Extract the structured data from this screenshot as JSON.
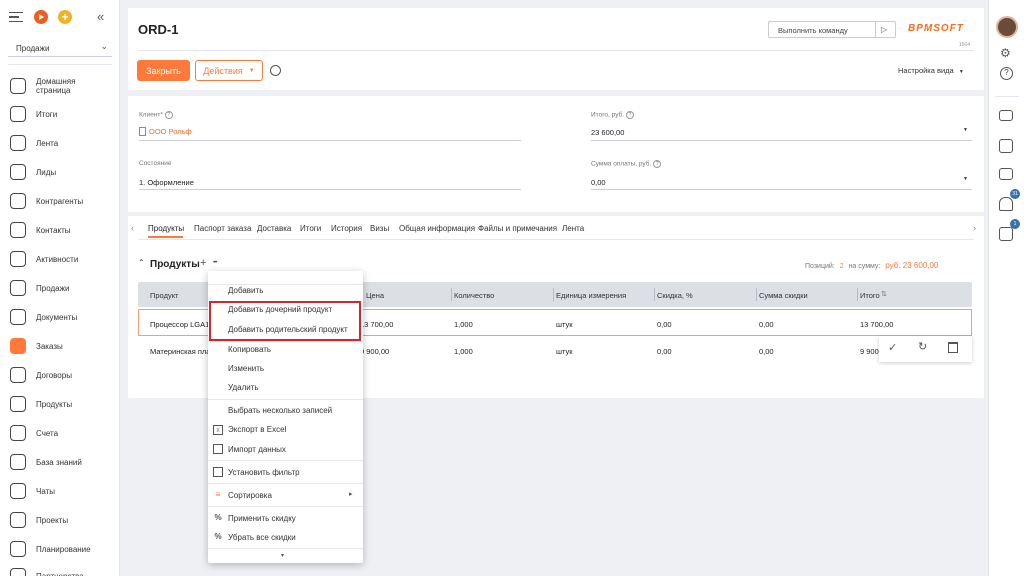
{
  "sidebar": {
    "workplace": "Продажи",
    "collapse_glyph": "«",
    "items": [
      {
        "label": "Домашняя\nстраница",
        "icon": "home-icon"
      },
      {
        "label": "Итоги",
        "icon": "pie-chart-icon"
      },
      {
        "label": "Лента",
        "icon": "feed-icon"
      },
      {
        "label": "Лиды",
        "icon": "lead-icon"
      },
      {
        "label": "Контрагенты",
        "icon": "account-icon"
      },
      {
        "label": "Контакты",
        "icon": "contact-icon"
      },
      {
        "label": "Активности",
        "icon": "flag-icon"
      },
      {
        "label": "Продажи",
        "icon": "opportunity-icon"
      },
      {
        "label": "Документы",
        "icon": "document-icon"
      },
      {
        "label": "Заказы",
        "icon": "cart-icon"
      },
      {
        "label": "Договоры",
        "icon": "contract-icon"
      },
      {
        "label": "Продукты",
        "icon": "product-icon"
      },
      {
        "label": "Счета",
        "icon": "invoice-icon"
      },
      {
        "label": "База знаний",
        "icon": "knowledge-icon"
      },
      {
        "label": "Чаты",
        "icon": "chat-icon"
      },
      {
        "label": "Проекты",
        "icon": "star-icon"
      },
      {
        "label": "Планирование",
        "icon": "check-circle-icon"
      },
      {
        "label": "Партнерства",
        "icon": "partners-icon"
      }
    ]
  },
  "header": {
    "title": "ORD-1",
    "command_placeholder": "Выполнить команду",
    "logo": "BPMSOFT",
    "logo_sub": "1504",
    "close_label": "Закрыть",
    "actions_label": "Действия",
    "view_settings_label": "Настройка вида"
  },
  "fields": {
    "client_label": "Клиент*",
    "client_value": "ООО Рольф",
    "total_label": "Итого, руб.",
    "total_value": "23 600,00",
    "state_label": "Состояние",
    "state_value": "1. Оформление",
    "paid_label": "Сумма оплаты, руб.",
    "paid_value": "0,00"
  },
  "tabs": [
    "Продукты",
    "Паспорт заказа",
    "Доставка",
    "Итоги",
    "История",
    "Визы",
    "Общая информация",
    "Файлы и примечания",
    "Лента"
  ],
  "products": {
    "title": "Продукты",
    "add_glyph": "+",
    "more_glyph": "•••",
    "positions_label": "Позиций:",
    "positions_value": "2",
    "sum_label": "на сумму:",
    "sum_value": "руб.  23 600,00",
    "columns": [
      "Продукт",
      "Цена",
      "Количество",
      "Единица измерения",
      "Скидка, %",
      "Сумма скидки",
      "Итого"
    ],
    "rows": [
      [
        "Процессор LGA1700 Intel Core i5-12400F",
        "13 700,00",
        "1,000",
        "штук",
        "0,00",
        "0,00",
        "13 700,00"
      ],
      [
        "Материнская плата",
        "9 900,00",
        "1,000",
        "штук",
        "0,00",
        "0,00",
        "9 900,"
      ]
    ]
  },
  "menu": {
    "items": [
      {
        "label": "Добавить"
      },
      {
        "label": "Добавить дочерний продукт"
      },
      {
        "label": "Добавить родительский продукт"
      },
      {
        "label": "Копировать"
      },
      {
        "label": "Изменить"
      },
      {
        "label": "Удалить"
      },
      {
        "label": "Выбрать несколько записей"
      },
      {
        "label": "Экспорт в Excel"
      },
      {
        "label": "Импорт данных"
      },
      {
        "label": "Установить фильтр"
      },
      {
        "label": "Сортировка"
      },
      {
        "label": "Применить скидку"
      },
      {
        "label": "Убрать все скидки"
      }
    ],
    "submenu_glyph": "▸",
    "scroll_glyph": "▾"
  },
  "rail": {
    "notif_badge": "31",
    "task_badge": "1"
  },
  "colors": {
    "accent": "#ff7a3a",
    "highlight_box": "#e0202a",
    "logo": "#ff6a1a"
  }
}
